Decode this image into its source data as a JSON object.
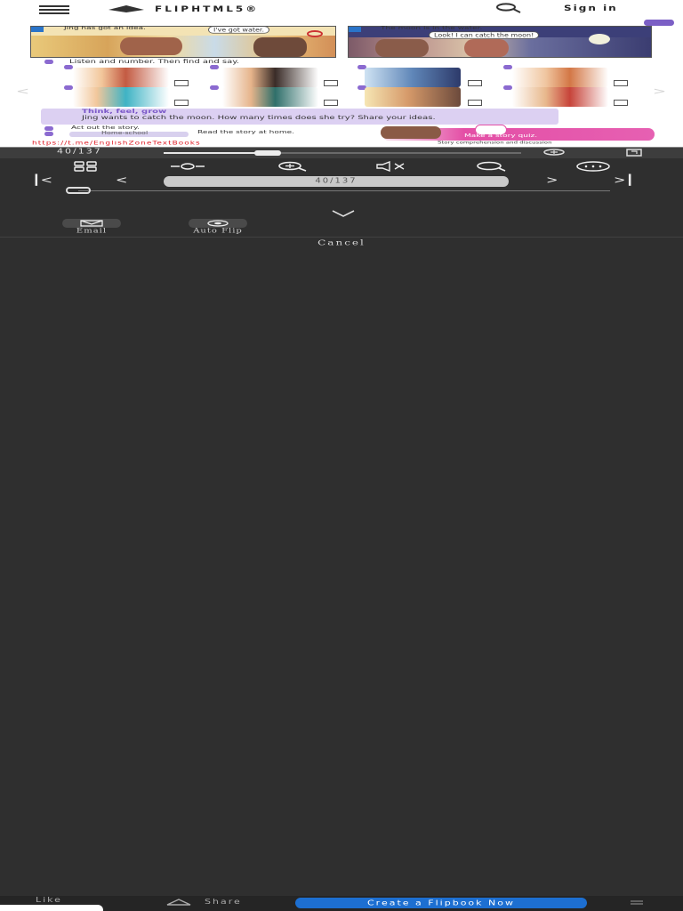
{
  "header": {
    "logo_text": "FLIPHTML5®",
    "sign_in": "Sign in"
  },
  "book_page": {
    "panel1_caption": "Jing has got an idea.",
    "panel1_bubble": "I've got water.",
    "panel2_caption": "The moon is in the water.",
    "panel2_bubble": "Look! I can catch the moon!",
    "activity3": "Listen and number. Then find and say.",
    "think_title": "Think, feel, grow",
    "think_question": "Jing wants to catch the moon. How many times does she try? Share your ideas.",
    "act_out": "Act out the story.",
    "home_school": "Home-school",
    "read_home": "Read the story at home.",
    "story_quiz": "Make a story quiz.",
    "footer_caption": "Story comprehension and discussion",
    "url": "https://t.me/EnglishZoneTextBooks"
  },
  "viewer": {
    "page_indicator": "40/137",
    "nav_page": "40/137",
    "progress_fraction": 0.29
  },
  "share_sheet": {
    "items": [
      {
        "label": "Email",
        "icon": "email-icon"
      },
      {
        "label": "Auto Flip",
        "icon": "auto-flip-icon"
      }
    ],
    "cancel": "Cancel"
  },
  "bottom_bar": {
    "like": "Like",
    "share": "Share",
    "create": "Create a Flipbook Now"
  },
  "colors": {
    "background": "#2f2f2f",
    "accent_blue": "#1d6fd1",
    "url_red": "#e0202a",
    "purple": "#8b6ad0"
  }
}
